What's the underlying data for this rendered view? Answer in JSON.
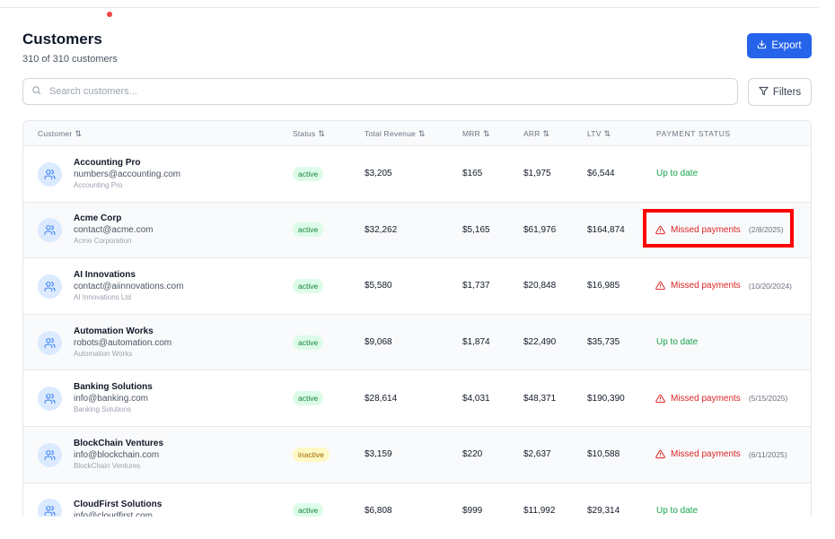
{
  "page": {
    "title": "Customers",
    "subtitle": "310 of 310 customers"
  },
  "toolbar": {
    "export_label": "Export",
    "filters_label": "Filters",
    "search_placeholder": "Search customers...",
    "search_value": ""
  },
  "table": {
    "columns": {
      "customer": "Customer",
      "status": "Status",
      "total_revenue": "Total Revenue",
      "mrr": "MRR",
      "arr": "ARR",
      "ltv": "LTV",
      "payment_status": "Payment Status"
    },
    "rows": [
      {
        "name": "Accounting Pro",
        "email": "numbers@accounting.com",
        "company": "Accounting Pro",
        "status": "active",
        "revenue": "$3,205",
        "mrr": "$165",
        "arr": "$1,975",
        "ltv": "$6,544",
        "payment": "Up to date",
        "payment_date": ""
      },
      {
        "name": "Acme Corp",
        "email": "contact@acme.com",
        "company": "Acme Corporation",
        "status": "active",
        "revenue": "$32,262",
        "mrr": "$5,165",
        "arr": "$61,976",
        "ltv": "$164,874",
        "payment": "Missed payments",
        "payment_date": "(2/8/2025)"
      },
      {
        "name": "AI Innovations",
        "email": "contact@aiinnovations.com",
        "company": "AI Innovations Ltd",
        "status": "active",
        "revenue": "$5,580",
        "mrr": "$1,737",
        "arr": "$20,848",
        "ltv": "$16,985",
        "payment": "Missed payments",
        "payment_date": "(10/20/2024)"
      },
      {
        "name": "Automation Works",
        "email": "robots@automation.com",
        "company": "Automation Works",
        "status": "active",
        "revenue": "$9,068",
        "mrr": "$1,874",
        "arr": "$22,490",
        "ltv": "$35,735",
        "payment": "Up to date",
        "payment_date": ""
      },
      {
        "name": "Banking Solutions",
        "email": "info@banking.com",
        "company": "Banking Solutions",
        "status": "active",
        "revenue": "$28,614",
        "mrr": "$4,031",
        "arr": "$48,371",
        "ltv": "$190,390",
        "payment": "Missed payments",
        "payment_date": "(5/15/2025)"
      },
      {
        "name": "BlockChain Ventures",
        "email": "info@blockchain.com",
        "company": "BlockChain Ventures",
        "status": "inactive",
        "revenue": "$3,159",
        "mrr": "$220",
        "arr": "$2,637",
        "ltv": "$10,588",
        "payment": "Missed payments",
        "payment_date": "(6/11/2025)"
      },
      {
        "name": "CloudFirst Solutions",
        "email": "info@cloudfirst.com",
        "company": "",
        "status": "active",
        "revenue": "$6,808",
        "mrr": "$999",
        "arr": "$11,992",
        "ltv": "$29,314",
        "payment": "Up to date",
        "payment_date": ""
      }
    ]
  },
  "colors": {
    "accent": "#2563eb",
    "active_badge": "#dcfce7",
    "inactive_badge": "#fef9c3",
    "missed": "#dc2626",
    "ok": "#16a34a",
    "highlight": "#ff0000"
  },
  "icons": {
    "export": "download-icon",
    "filters": "funnel-icon",
    "search": "search-icon",
    "avatar": "users-icon",
    "sort": "sort-icon",
    "missed": "warning-triangle-icon"
  }
}
